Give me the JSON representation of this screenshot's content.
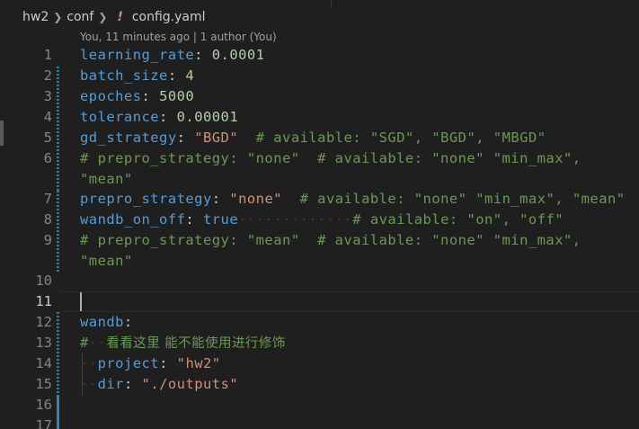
{
  "breadcrumb": {
    "folder1": "hw2",
    "folder2": "conf",
    "file_icon": "!",
    "file": "config.yaml"
  },
  "codelens": "You, 11 minutes ago | 1 author (You)",
  "line_numbers": [
    "1",
    "2",
    "3",
    "4",
    "5",
    "6",
    "7",
    "8",
    "9",
    "10",
    "11",
    "12",
    "13",
    "14",
    "15",
    "16",
    "17"
  ],
  "code": {
    "l1": {
      "key": "learning_rate",
      "colon": ":",
      "value": "0.0001"
    },
    "l2": {
      "key": "batch_size",
      "colon": ":",
      "value": "4"
    },
    "l3": {
      "key": "epoches",
      "colon": ":",
      "value": "5000"
    },
    "l4": {
      "key": "tolerance",
      "colon": ":",
      "value": "0.00001"
    },
    "l5": {
      "key": "gd_strategy",
      "colon": ":",
      "value": "\"BGD\"",
      "comment": "# available: \"SGD\", \"BGD\", \"MBGD\""
    },
    "l6": {
      "comment": "# prepro_strategy: \"none\"  # available: \"none\" \"min_max\",",
      "wrap": "\"mean\""
    },
    "l7": {
      "key": "prepro_strategy",
      "colon": ":",
      "value": "\"none\"",
      "comment": "# available: \"none\" \"min_max\", \"mean\""
    },
    "l8": {
      "key": "wandb_on_off",
      "colon": ":",
      "value": "true",
      "dots": "·············",
      "comment": "# available: \"on\", \"off\""
    },
    "l9": {
      "comment": "# prepro_strategy: \"mean\"  # available: \"none\" \"min_max\",",
      "wrap": "\"mean\""
    },
    "l12": {
      "key": "wandb",
      "colon": ":"
    },
    "l13": {
      "comment_hash": "#",
      "comment_text": "看看这里 能不能使用进行修饰"
    },
    "l14": {
      "key": "project",
      "colon": ":",
      "value": "\"hw2\""
    },
    "l15": {
      "key": "dir",
      "colon": ":",
      "value": "\"./outputs\""
    }
  },
  "colors": {
    "background": "#1f1f1f",
    "key": "#569cd6",
    "string": "#ce9178",
    "number": "#b5cea8",
    "comment": "#6a9955",
    "line_number": "#858585",
    "git_modified": "#1b81a8"
  }
}
